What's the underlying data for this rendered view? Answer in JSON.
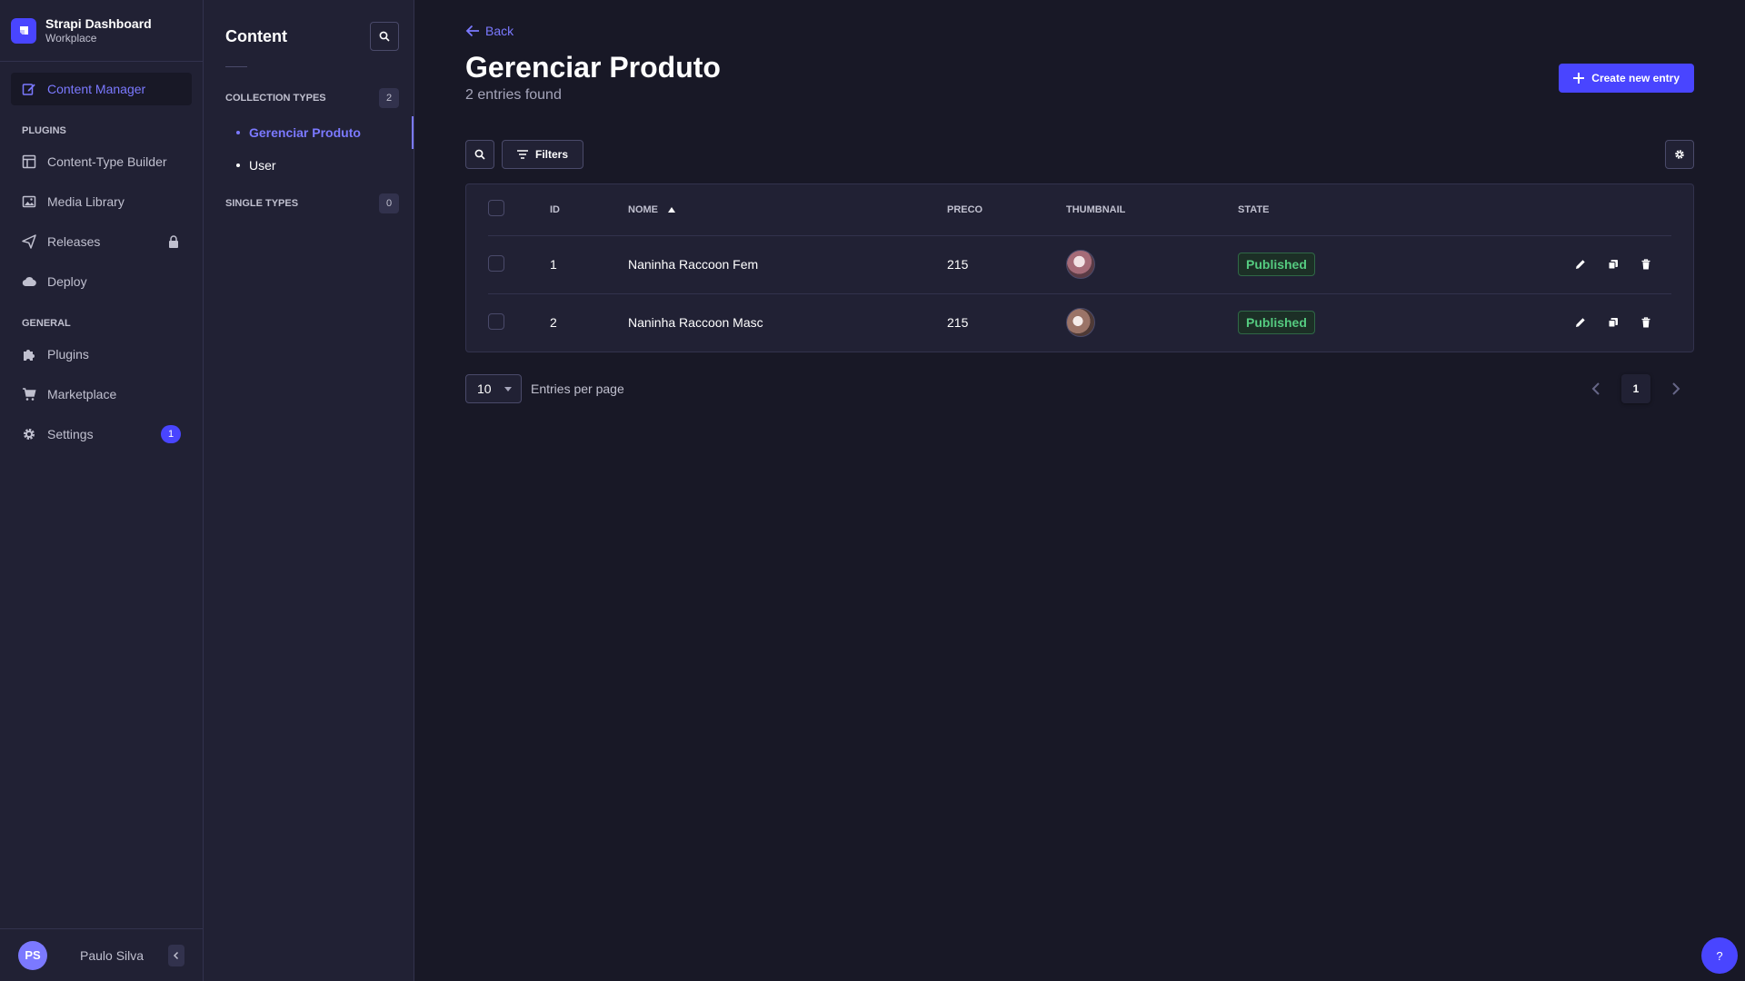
{
  "brand": {
    "title": "Strapi Dashboard",
    "subtitle": "Workplace"
  },
  "mainnav": {
    "active": "Content Manager",
    "sections": {
      "plugins": "PLUGINS",
      "general": "GENERAL"
    },
    "items": {
      "content_manager": "Content Manager",
      "content_type_builder": "Content-Type Builder",
      "media_library": "Media Library",
      "releases": "Releases",
      "deploy": "Deploy",
      "plugins": "Plugins",
      "marketplace": "Marketplace",
      "settings": "Settings"
    },
    "settings_badge": "1",
    "user": {
      "initials": "PS",
      "name": "Paulo Silva"
    }
  },
  "subnav": {
    "title": "Content",
    "collection_types": {
      "label": "COLLECTION TYPES",
      "count": "2",
      "items": [
        "Gerenciar Produto",
        "User"
      ]
    },
    "single_types": {
      "label": "SINGLE TYPES",
      "count": "0"
    }
  },
  "page": {
    "back_label": "Back",
    "title": "Gerenciar Produto",
    "subtitle": "2 entries found",
    "create_label": "Create new entry",
    "filters_label": "Filters"
  },
  "table": {
    "headers": {
      "id": "ID",
      "nome": "NOME",
      "preco": "PRECO",
      "thumbnail": "THUMBNAIL",
      "state": "STATE"
    },
    "rows": [
      {
        "id": "1",
        "nome": "Naninha Raccoon Fem",
        "preco": "215",
        "state": "Published"
      },
      {
        "id": "2",
        "nome": "Naninha Raccoon Masc",
        "preco": "215",
        "state": "Published"
      }
    ]
  },
  "pagination": {
    "per_page": "10",
    "per_page_label": "Entries per page",
    "current_page": "1"
  },
  "help": {
    "label": "?"
  },
  "colors": {
    "accent": "#4945ff",
    "accent_text": "#7b79ff",
    "success": "#55cb80",
    "bg": "#181826",
    "panel": "#212134"
  }
}
